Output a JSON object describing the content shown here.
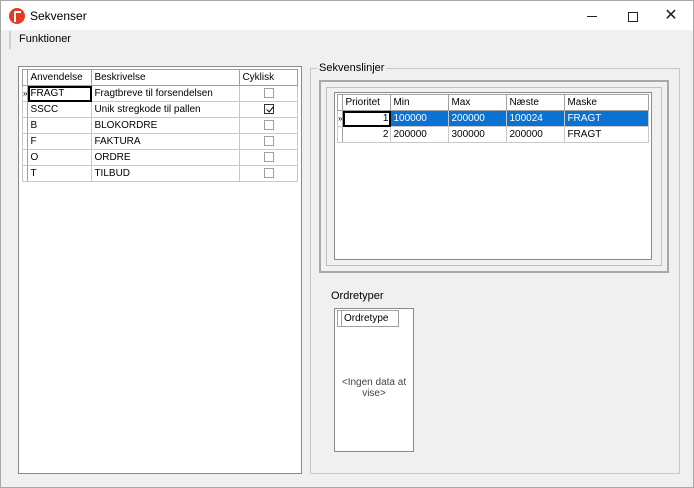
{
  "window": {
    "title": "Sekvenser",
    "minimize_label": "—",
    "maximize_label": "□",
    "close_label": "✕"
  },
  "menu": {
    "funktioner": "Funktioner"
  },
  "sequences": {
    "columns": [
      "Anvendelse",
      "Beskrivelse",
      "Cyklisk"
    ],
    "rows": [
      {
        "anvendelse": "FRAGT",
        "beskrivelse": "Fragtbreve til forsendelsen",
        "cyklisk": false,
        "current": true
      },
      {
        "anvendelse": "SSCC",
        "beskrivelse": "Unik stregkode til pallen",
        "cyklisk": true,
        "current": false
      },
      {
        "anvendelse": "B",
        "beskrivelse": "BLOKORDRE",
        "cyklisk": false,
        "current": false
      },
      {
        "anvendelse": "F",
        "beskrivelse": "FAKTURA",
        "cyklisk": false,
        "current": false
      },
      {
        "anvendelse": "O",
        "beskrivelse": "ORDRE",
        "cyklisk": false,
        "current": false
      },
      {
        "anvendelse": "T",
        "beskrivelse": "TILBUD",
        "cyklisk": false,
        "current": false
      }
    ]
  },
  "sekvenslinjer": {
    "label": "Sekvenslinjer",
    "columns": [
      "Prioritet",
      "Min",
      "Max",
      "Næste",
      "Maske"
    ],
    "rows": [
      {
        "prioritet": "1",
        "min": "100000",
        "max": "200000",
        "naeste": "100024",
        "maske": "FRAGT",
        "selected": true
      },
      {
        "prioritet": "2",
        "min": "200000",
        "max": "300000",
        "naeste": "200000",
        "maske": "FRAGT",
        "selected": false
      }
    ]
  },
  "ordretyper": {
    "label": "Ordretyper",
    "columns": [
      "Ordretype"
    ],
    "empty_message": "<Ingen data at vise>"
  },
  "colors": {
    "selection": "#0a72d2",
    "app_icon": "#e63a24"
  }
}
